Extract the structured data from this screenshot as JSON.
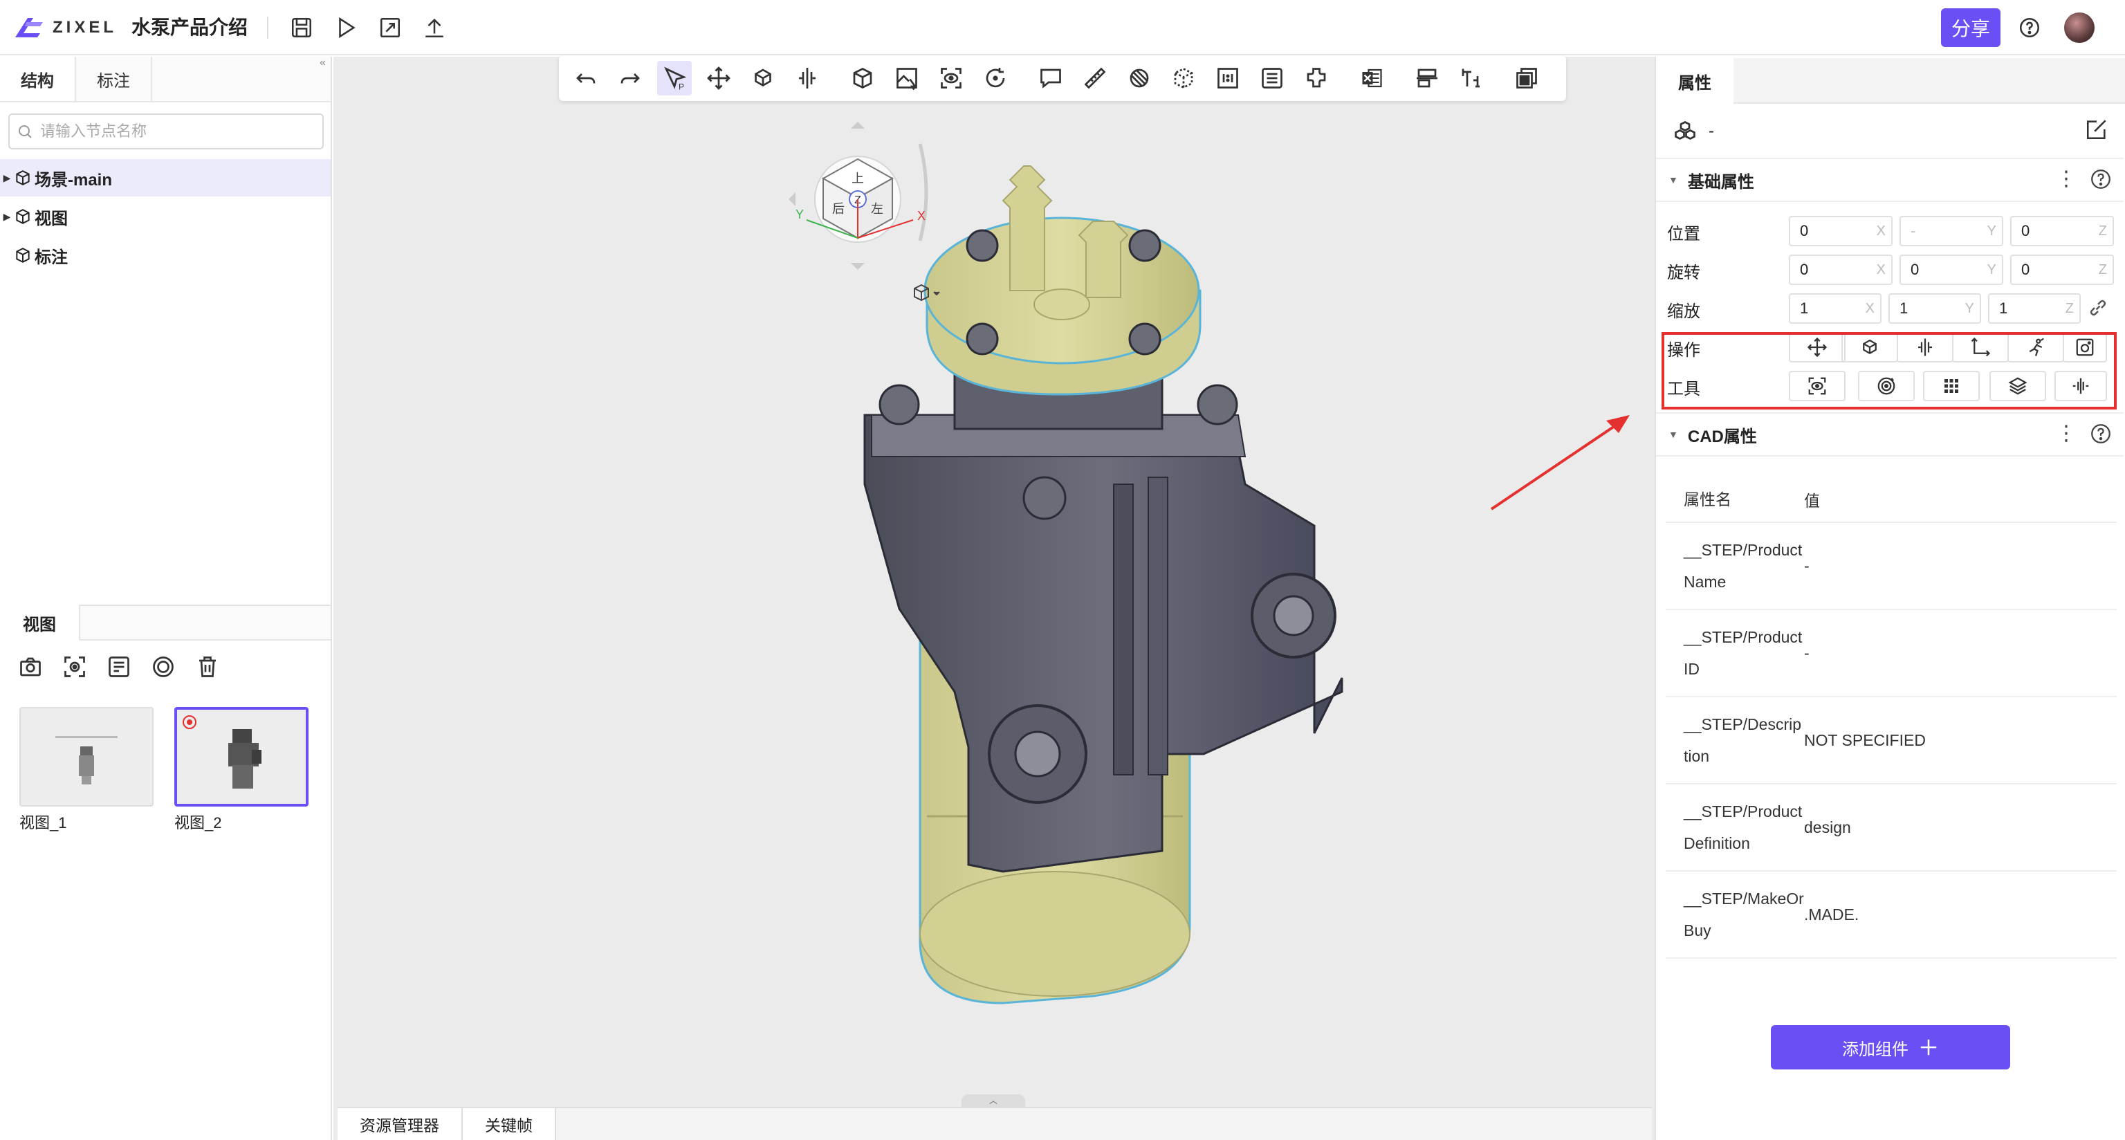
{
  "app": {
    "logo_text": "ZIXEL",
    "doc_title": "水泵产品介绍",
    "share_label": "分享"
  },
  "left_panel": {
    "tabs": [
      "结构",
      "标注"
    ],
    "search_placeholder": "请输入节点名称",
    "tree": [
      {
        "label": "场景-main",
        "expandable": true,
        "selected": true
      },
      {
        "label": "视图",
        "expandable": true,
        "selected": false
      },
      {
        "label": "标注",
        "expandable": false,
        "selected": false
      }
    ],
    "views_tab": "视图",
    "views": [
      {
        "label": "视图_1",
        "selected": false
      },
      {
        "label": "视图_2",
        "selected": true
      }
    ]
  },
  "viewport": {
    "bottom_tabs": [
      "资源管理器",
      "关键帧"
    ],
    "nav_cube": {
      "top": "Z",
      "faces": [
        "后",
        "左",
        "上"
      ],
      "axes": [
        "X",
        "Y",
        "Z"
      ]
    }
  },
  "right_panel": {
    "tab": "属性",
    "object_name": "-",
    "basic_section": "基础属性",
    "position": {
      "label": "位置",
      "x": "0",
      "y": "-",
      "z": "0"
    },
    "rotation": {
      "label": "旋转",
      "x": "0",
      "y": "0",
      "z": "0"
    },
    "scale": {
      "label": "缩放",
      "x": "1",
      "y": "1",
      "z": "1"
    },
    "axis_letters": {
      "x": "X",
      "y": "Y",
      "z": "Z"
    },
    "operate_label": "操作",
    "tools_label": "工具",
    "cad_section": "CAD属性",
    "cad_headers": {
      "name": "属性名",
      "value": "值"
    },
    "cad_rows": [
      {
        "name": "__STEP/ProductName",
        "value": "-"
      },
      {
        "name": "__STEP/ProductID",
        "value": "-"
      },
      {
        "name": "__STEP/Description",
        "value": "NOT SPECIFIED"
      },
      {
        "name": "__STEP/ProductDefinition",
        "value": "design"
      },
      {
        "name": "__STEP/MakeOrBuy",
        "value": ".MADE."
      }
    ],
    "add_component_label": "添加组件"
  },
  "colors": {
    "accent": "#6a4ff5",
    "highlight_red": "#e4302f",
    "model_yellow": "#d9d79a",
    "model_metal": "#5a5c6a"
  }
}
